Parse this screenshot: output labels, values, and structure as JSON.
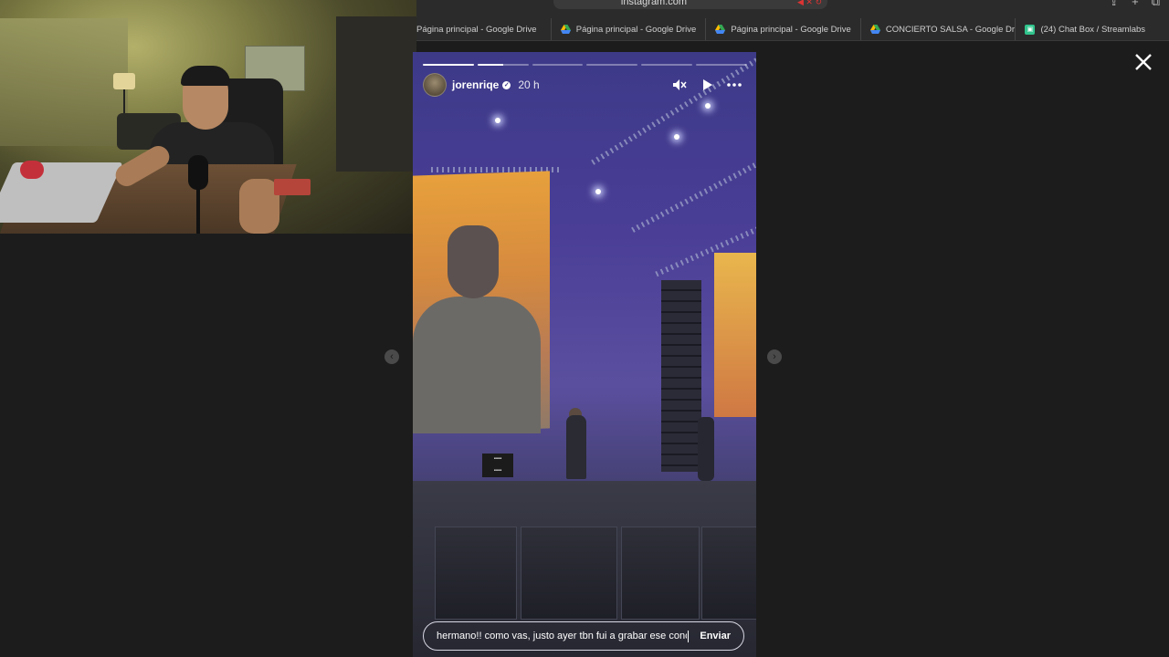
{
  "browser": {
    "url": "instagram.com",
    "tabs": [
      {
        "label": "Página principal - Google Drive",
        "icon": "google-drive-icon"
      },
      {
        "label": "Página principal - Google Drive",
        "icon": "google-drive-icon"
      },
      {
        "label": "Página principal - Google Drive",
        "icon": "google-drive-icon"
      },
      {
        "label": "CONCIERTO SALSA - Google Dri...",
        "icon": "google-drive-icon"
      },
      {
        "label": "(24) Chat Box / Streamlabs",
        "icon": "streamlabs-icon"
      }
    ]
  },
  "story": {
    "username": "jorenriqe",
    "verified": true,
    "time_ago": "20 h",
    "progress": {
      "segments": 6,
      "completed": 1,
      "current": 2,
      "current_fraction": 0.5
    },
    "reply": {
      "text": "hermano!! como vas, justo ayer tbn fui a grabar ese conco",
      "send_label": "Enviar"
    },
    "icons": {
      "mute": "muted-speaker-icon",
      "play": "play-icon",
      "more": "more-options-icon",
      "close": "close-icon",
      "prev": "chevron-left-icon",
      "next": "chevron-right-icon"
    }
  },
  "colors": {
    "background": "#1c1c1c",
    "story_tint": "#4a3e97",
    "text": "#ffffff"
  }
}
